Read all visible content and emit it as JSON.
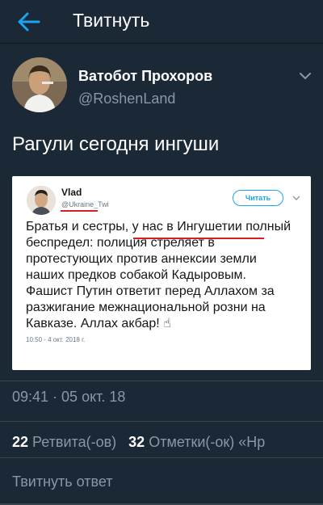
{
  "header": {
    "title": "Твитнуть"
  },
  "author": {
    "name": "Ватобот Прохоров",
    "handle": "@RoshenLand"
  },
  "tweet": {
    "text": "Рагули сегодня ингуши"
  },
  "embedded": {
    "name": "Vlad",
    "handle": "@Ukraine_Twi",
    "follow_label": "Читать",
    "lines": [
      "Братья и сестры, у нас в Ингушетии полный",
      "беспредел: полиция стреляет в",
      "протестующих против аннексии земли",
      "наших предков собакой Кадыровым.",
      "Фашист Путин ответит перед Аллахом за",
      "разжигание межнациональной розни на",
      "Кавказе. Аллах акбар! ☝"
    ],
    "time": "10:50 - 4 окт. 2018 г."
  },
  "timestamp": "09:41 · 05 окт. 18",
  "stats": {
    "retweets_count": "22",
    "retweets_label": "Ретвита(-ов)",
    "likes_count": "32",
    "likes_label": "Отметки(-ок) «Нр"
  },
  "reply": {
    "placeholder": "Твитнуть ответ"
  },
  "colors": {
    "background": "#1b2836",
    "accent": "#1da1f2",
    "muted": "#8899a6",
    "underline": "#d32020"
  }
}
